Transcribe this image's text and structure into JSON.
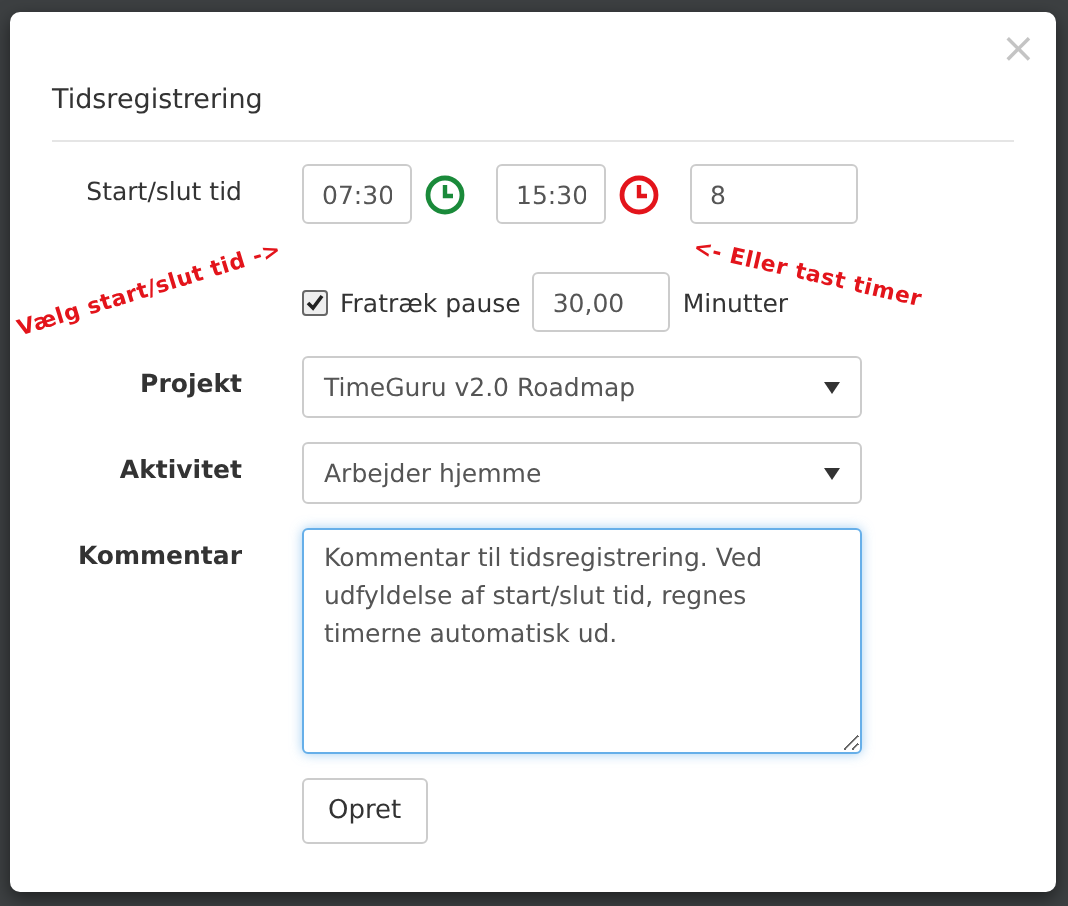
{
  "dialog": {
    "title": "Tidsregistrering",
    "close": "×"
  },
  "time_row": {
    "label": "Start/slut tid",
    "start": "07:30",
    "end": "15:30",
    "hours": "8"
  },
  "pause": {
    "checked": true,
    "label": "Fratræk pause",
    "value": "30,00",
    "unit": "Minutter"
  },
  "annotations": [
    {
      "text": "Vælg start/slut tid ->"
    },
    {
      "text": "<- Eller tast timer"
    }
  ],
  "fields": [
    {
      "kind": "select",
      "label": "Projekt",
      "value": "TimeGuru v2.0 Roadmap"
    },
    {
      "kind": "select",
      "label": "Aktivitet",
      "value": "Arbejder hjemme"
    },
    {
      "kind": "textarea",
      "label": "Kommentar",
      "value": "Kommentar til tidsregistrering. Ved udfyldelse af start/slut tid, regnes timerne automatisk ud."
    }
  ],
  "submit": "Opret"
}
